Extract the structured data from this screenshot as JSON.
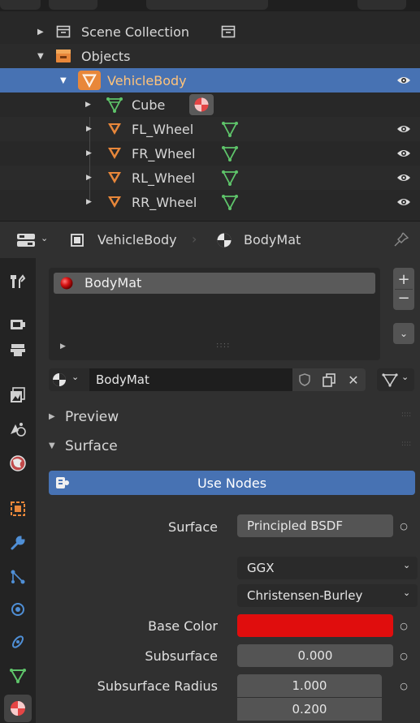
{
  "outliner": {
    "rows": [
      {
        "label": "Scene Collection"
      },
      {
        "label": "Objects"
      },
      {
        "label": "VehicleBody"
      },
      {
        "label": "Cube"
      },
      {
        "label": "FL_Wheel"
      },
      {
        "label": "FR_Wheel"
      },
      {
        "label": "RL_Wheel"
      },
      {
        "label": "RR_Wheel"
      }
    ]
  },
  "props_header": {
    "object_name": "VehicleBody",
    "material_name": "BodyMat"
  },
  "material_slots": {
    "items": [
      {
        "label": "BodyMat"
      }
    ],
    "add_label": "+",
    "remove_label": "−"
  },
  "material_selector": {
    "name": "BodyMat"
  },
  "sections": {
    "preview": "Preview",
    "surface": "Surface"
  },
  "use_nodes_label": "Use Nodes",
  "surface": {
    "surface_label": "Surface",
    "surface_value": "Principled BSDF",
    "distribution": "GGX",
    "subsurface_method": "Christensen-Burley",
    "base_color_label": "Base Color",
    "base_color": "#e00d0d",
    "subsurface_label": "Subsurface",
    "subsurface_value": "0.000",
    "subsurface_radius_label": "Subsurface Radius",
    "subsurface_radius_1": "1.000",
    "subsurface_radius_2": "0.200"
  },
  "colors": {
    "selection": "#4772b3",
    "object_orange": "#e8873a",
    "mesh_green": "#5ec46a"
  }
}
